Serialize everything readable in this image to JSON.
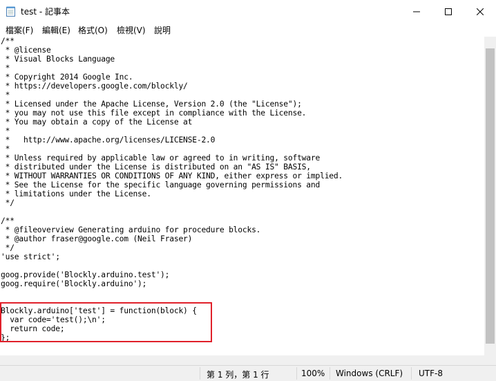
{
  "window": {
    "title": "test - 記事本",
    "minimize_glyph": "—",
    "maximize_glyph": "☐",
    "close_glyph": "✕"
  },
  "menu": [
    "檔案(F)",
    "編輯(E)",
    "格式(O)",
    "檢視(V)",
    "說明"
  ],
  "editor": {
    "lines": [
      "/**",
      " * @license",
      " * Visual Blocks Language",
      " *",
      " * Copyright 2014 Google Inc.",
      " * https://developers.google.com/blockly/",
      " *",
      " * Licensed under the Apache License, Version 2.0 (the \"License\");",
      " * you may not use this file except in compliance with the License.",
      " * You may obtain a copy of the License at",
      " *",
      " *   http://www.apache.org/licenses/LICENSE-2.0",
      " *",
      " * Unless required by applicable law or agreed to in writing, software",
      " * distributed under the License is distributed on an \"AS IS\" BASIS,",
      " * WITHOUT WARRANTIES OR CONDITIONS OF ANY KIND, either express or implied.",
      " * See the License for the specific language governing permissions and",
      " * limitations under the License.",
      " */",
      "",
      "/**",
      " * @fileoverview Generating arduino for procedure blocks.",
      " * @author fraser@google.com (Neil Fraser)",
      " */",
      "'use strict';",
      "",
      "goog.provide('Blockly.arduino.test');",
      "goog.require('Blockly.arduino');",
      "",
      "",
      "Blockly.arduino['test'] = function(block) {",
      "  var code='test();\\n';",
      "  return code;",
      "};"
    ]
  },
  "status": {
    "position": "第 1 列，第 1 行",
    "zoom": "100%",
    "line_ending": "Windows (CRLF)",
    "encoding": "UTF-8"
  },
  "colors": {
    "highlight_border": "#e0202a"
  }
}
